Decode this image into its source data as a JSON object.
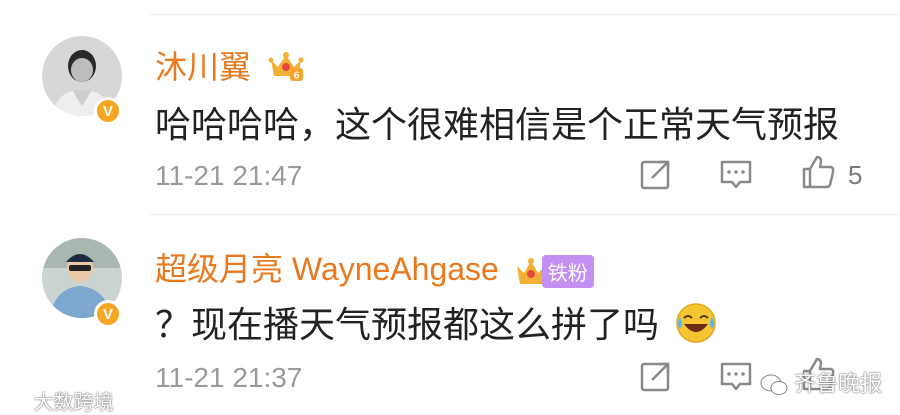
{
  "comments": [
    {
      "username": "沐川翼",
      "text": "哈哈哈哈，这个很难相信是个正常天气预报",
      "timestamp": "11-21 21:47",
      "like_count": "5",
      "crown_level": "6",
      "verified_mark": "V"
    },
    {
      "username": "超级月亮 WayneAhgase",
      "text": "？现在播天气预报都这么拼了吗",
      "timestamp": "11-21 21:37",
      "fan_badge": "铁粉",
      "verified_mark": "V"
    }
  ],
  "watermarks": {
    "left": "大数跨境",
    "right": "齐鲁晚报"
  },
  "colors": {
    "username": "#e8791e",
    "timestamp": "#9a9a9a",
    "badge": "#f6a623",
    "fan_badge": "#c38ff0"
  },
  "icons": [
    "repost-icon",
    "comment-icon",
    "like-icon",
    "crown-icon",
    "laughing-emoji-icon"
  ]
}
